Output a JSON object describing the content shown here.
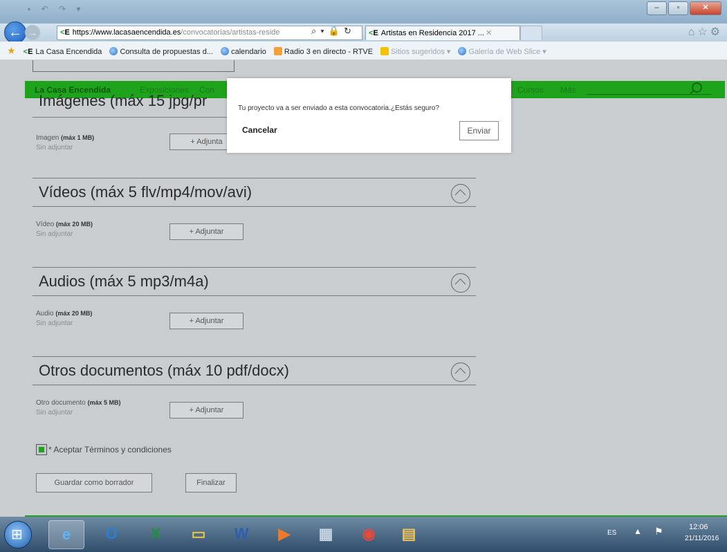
{
  "browser": {
    "url_site": "https://www.lacasaencendida.es",
    "url_path": "/convocatorias/artistas-reside",
    "tab_title": "Artistas en Residencia 2017 ...",
    "favorites": [
      "La Casa Encendida",
      "Consulta de propuestas d...",
      "calendario",
      "Radio 3 en directo - RTVE",
      "Sitios sugeridos ▾",
      "Galería de Web Slice ▾"
    ]
  },
  "site_nav": {
    "brand": "La Casa Encendida",
    "items": [
      "Exposiciones",
      "Con",
      "Cursos",
      "Más"
    ]
  },
  "sections": [
    {
      "title": "Imágenes (máx 15 jpg/pr",
      "field_label": "Imagen",
      "field_limit": "(máx 1 MB)",
      "status": "Sin adjuntar",
      "button": "+ Adjunta"
    },
    {
      "title": "Vídeos (máx 5 flv/mp4/mov/avi)",
      "field_label": "Vídeo",
      "field_limit": "(máx 20 MB)",
      "status": "Sin adjuntar",
      "button": "+ Adjuntar"
    },
    {
      "title": "Audios (máx 5 mp3/m4a)",
      "field_label": "Audio",
      "field_limit": "(máx 20 MB)",
      "status": "Sin adjuntar",
      "button": "+ Adjuntar"
    },
    {
      "title": "Otros documentos (máx 10 pdf/docx)",
      "field_label": "Otro documento",
      "field_limit": "(máx 5 MB)",
      "status": "Sin adjuntar",
      "button": "+ Adjuntar"
    }
  ],
  "terms": {
    "label": "* Aceptar Términos y condiciones",
    "checked": true
  },
  "buttons": {
    "draft": "Guardar como borrador",
    "finish": "Finalizar"
  },
  "modal": {
    "message": "Tu proyecto va a ser enviado a esta convocatoria.¿Estás seguro?",
    "cancel": "Cancelar",
    "send": "Enviar"
  },
  "taskbar": {
    "lang": "ES",
    "time": "12:06",
    "date": "21/11/2016"
  },
  "colors": {
    "accent_green": "#1fa31d"
  }
}
